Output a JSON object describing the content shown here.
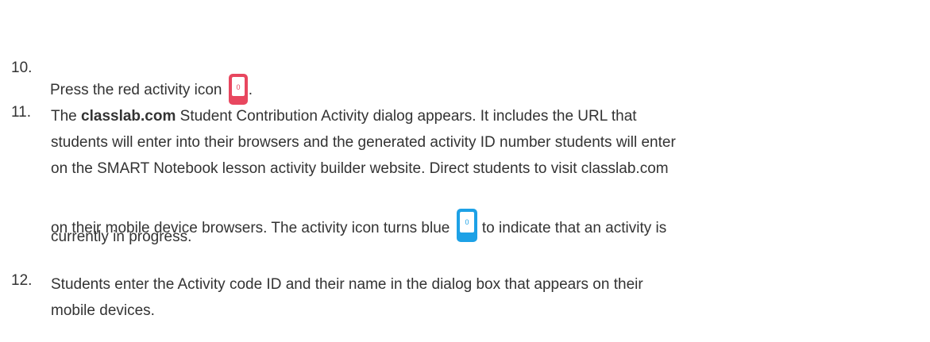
{
  "steps": [
    {
      "number": "10.",
      "before_icon": "Press the red activity icon",
      "icon": "activity-icon-red",
      "icon_color": "#e8475f",
      "after_icon": "."
    },
    {
      "number": "11.",
      "prefix": "The ",
      "bold": "classlab.com",
      "line1_rest": " Student Contribution Activity dialog appears. It includes the URL that",
      "line2": "students will enter into their browsers and the generated activity ID number students will enter",
      "line3": "on the SMART Notebook lesson activity builder website. Direct students to visit classlab.com",
      "line4_before_icon": "on their mobile device browsers. The activity icon turns blue",
      "icon": "activity-icon-blue",
      "icon_color": "#1da1e6",
      "line4_after_icon": " to indicate that an activity is",
      "line5": "currently in progress."
    },
    {
      "number": "12.",
      "line1": "Students enter the Activity code ID and their name in the dialog box that appears on their",
      "line2": "mobile devices."
    }
  ],
  "icon_label": "0"
}
